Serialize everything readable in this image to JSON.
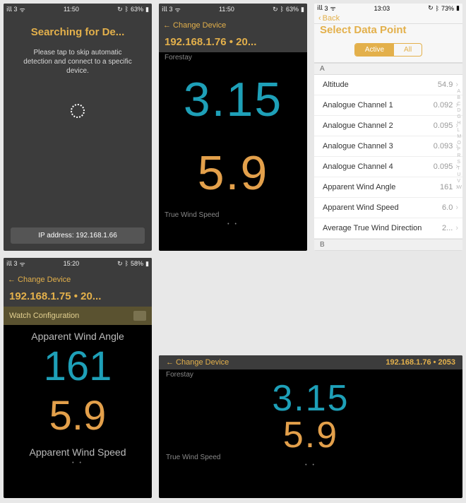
{
  "status": {
    "carrier": "3",
    "signal_icon": "📶",
    "wifi_icon": "📡",
    "bt_icon": "🔵",
    "times": {
      "s1": "11:50",
      "s2": "11:50",
      "s3": "13:03",
      "s4": "15:20"
    },
    "battery": {
      "s1": "63%",
      "s2": "63%",
      "s3": "73%",
      "s4": "58%"
    }
  },
  "s1": {
    "title": "Searching for De...",
    "hint_l1": "Please tap to skip automatic",
    "hint_l2": "detection and connect to a specific",
    "hint_l3": "device.",
    "ip_label": "IP address: 192.168.1.66"
  },
  "s2": {
    "change_device": "← Change Device",
    "ip_line": "192.168.1.76 • 20...",
    "top_label": "Forestay",
    "val_top": "3.15",
    "val_bottom": "5.9",
    "bottom_label": "True Wind Speed",
    "dots": "• •"
  },
  "s3": {
    "back": "Back",
    "title": "Select Data Point",
    "seg_active": "Active",
    "seg_all": "All",
    "divider_a": "A",
    "divider_b": "B",
    "rows": [
      {
        "k": "Altitude",
        "v": "54.9"
      },
      {
        "k": "Analogue Channel 1",
        "v": "0.092"
      },
      {
        "k": "Analogue Channel 2",
        "v": "0.095"
      },
      {
        "k": "Analogue Channel 3",
        "v": "0.093"
      },
      {
        "k": "Analogue Channel 4",
        "v": "0.095"
      },
      {
        "k": "Apparent Wind Angle",
        "v": "161"
      },
      {
        "k": "Apparent Wind Speed",
        "v": "6.0"
      },
      {
        "k": "Average True Wind Direction",
        "v": "2..."
      }
    ],
    "index": [
      "A",
      "B",
      "C",
      "D",
      "G",
      "H",
      "L",
      "M",
      "O",
      "P",
      "R",
      "S",
      "T",
      "U",
      "V",
      "W"
    ]
  },
  "s4": {
    "change_device": "← Change Device",
    "ip_line": "192.168.1.75 • 20...",
    "watch_cfg": "Watch Configuration",
    "top_label": "Apparent Wind Angle",
    "val_top": "161",
    "val_bottom": "5.9",
    "bottom_label": "Apparent Wind Speed",
    "dots": "• •"
  },
  "s5": {
    "change_device": "← Change Device",
    "ip_line": "192.168.1.76 • 2053",
    "top_label": "Forestay",
    "val_top": "3.15",
    "val_bottom": "5.9",
    "bottom_label": "True Wind Speed",
    "dots": "• •"
  }
}
